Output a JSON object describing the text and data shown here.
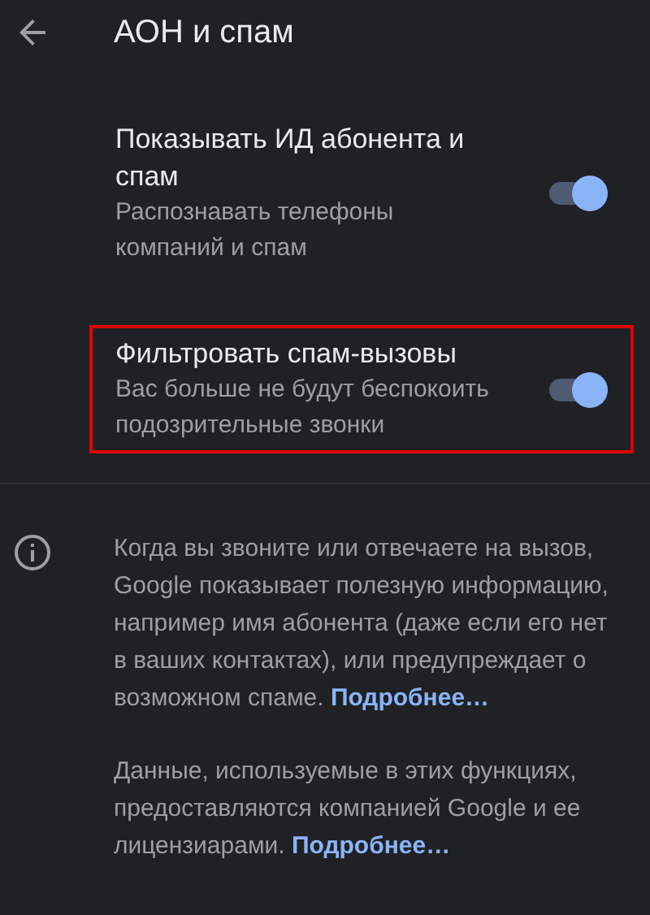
{
  "app_bar": {
    "title": "АОН и спам"
  },
  "settings": [
    {
      "title": "Показывать ИД абонента и спам",
      "summary": "Распознавать телефоны компаний и спам",
      "on": true,
      "highlighted": false
    },
    {
      "title": "Фильтровать спам-вызовы",
      "summary": "Вас больше не будут беспокоить подозрительные звонки",
      "on": true,
      "highlighted": true
    }
  ],
  "info": [
    {
      "text": "Когда вы звоните или отвечаете на вызов, Google показывает полезную информацию, например имя абонента (даже если его нет в ваших контактах), или предупреждает о возможном спаме.",
      "link": "Подробнее…"
    },
    {
      "text": "Данные, используемые в этих функциях, предоставляются компанией Google и ее лицензиарами.",
      "link": "Подробнее…"
    }
  ]
}
